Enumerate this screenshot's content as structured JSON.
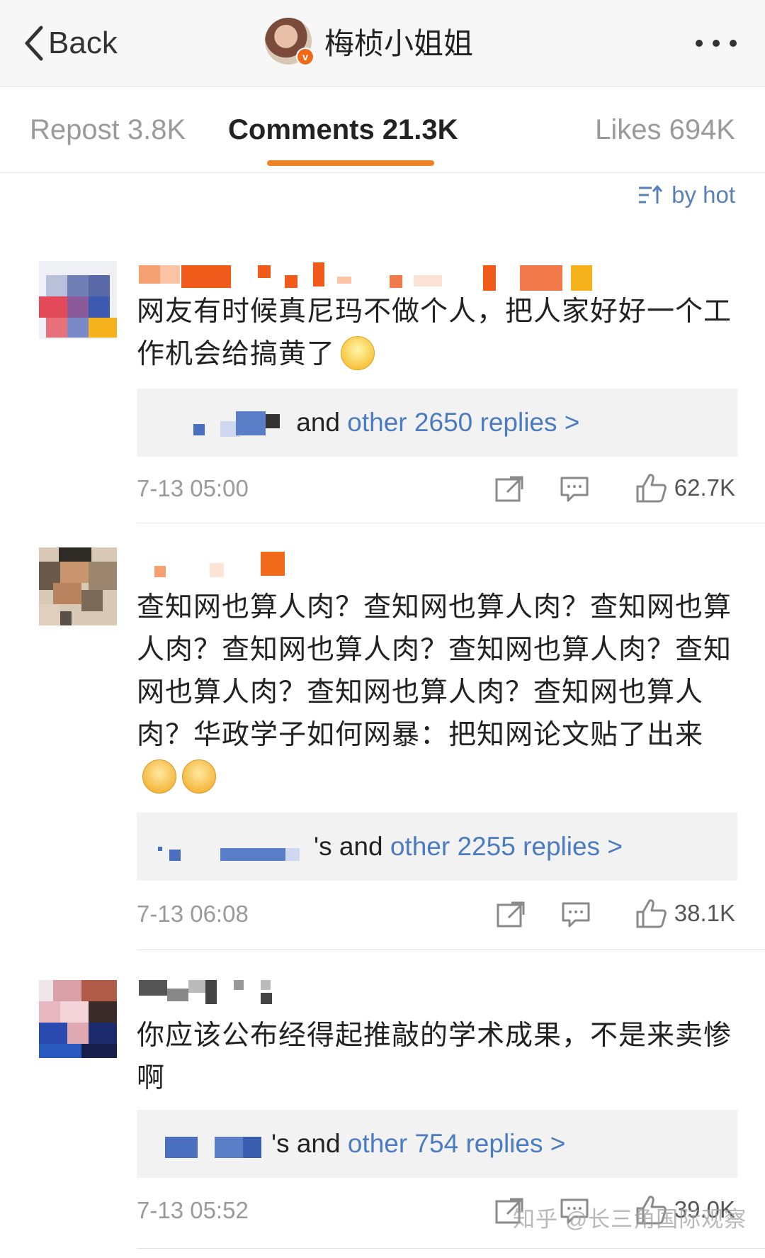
{
  "header": {
    "back_label": "Back",
    "title": "梅桢小姐姐",
    "badge": "v"
  },
  "tabs": [
    {
      "label": "Repost 3.8K",
      "active": false
    },
    {
      "label": "Comments 21.3K",
      "active": true
    },
    {
      "label": "Likes 694K",
      "active": false
    }
  ],
  "sort_label": "by hot",
  "accent_color": "#f08424",
  "link_color": "#4b7bc0",
  "comments": [
    {
      "text": "网友有时候真尼玛不做个人，把人家好好一个工作机会给搞黄了",
      "emoji": [
        "smile"
      ],
      "replies_prefix": " and ",
      "replies_link": "other 2650 replies >",
      "time": "7-13 05:00",
      "likes": "62.7K"
    },
    {
      "text": "查知网也算人肉？查知网也算人肉？查知网也算人肉？查知网也算人肉？查知网也算人肉？查知网也算人肉？查知网也算人肉？查知网也算人肉？华政学子如何网暴：把知网论文贴了出来",
      "emoji": [
        "pleading",
        "pleading"
      ],
      "replies_prefix": "'s and ",
      "replies_link": "other 2255 replies >",
      "time": "7-13 06:08",
      "likes": "38.1K"
    },
    {
      "text": "你应该公布经得起推敲的学术成果，不是来卖惨啊",
      "emoji": [],
      "replies_prefix": "'s and ",
      "replies_link": "other 754 replies >",
      "time": "7-13 05:52",
      "likes": "39.0K"
    }
  ],
  "watermark": "知乎 @长三角国际观察"
}
